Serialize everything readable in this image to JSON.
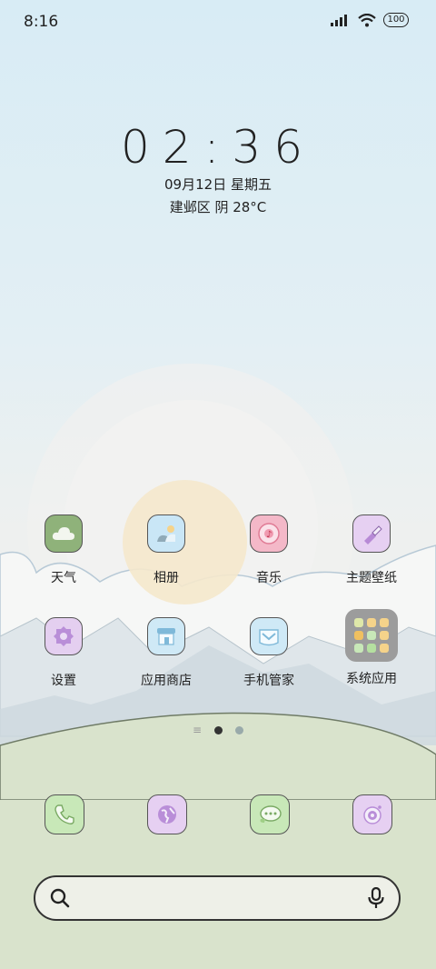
{
  "status_bar": {
    "time": "8:16",
    "battery": "100"
  },
  "clock": {
    "time": "02:36",
    "date": "09月12日 星期五",
    "weather": "建邺区 阴 28°C"
  },
  "apps_row1": [
    {
      "label": "天气",
      "icon": "weather-icon",
      "color": "#8fb27a"
    },
    {
      "label": "相册",
      "icon": "gallery-icon",
      "color": "#c9e6f6"
    },
    {
      "label": "音乐",
      "icon": "music-icon",
      "color": "#f4b8c8"
    },
    {
      "label": "主题壁纸",
      "icon": "themes-icon",
      "color": "#e6d0f2"
    }
  ],
  "apps_row2": [
    {
      "label": "设置",
      "icon": "settings-icon",
      "color": "#e4cff0"
    },
    {
      "label": "应用商店",
      "icon": "app-store-icon",
      "color": "#cfe9f6"
    },
    {
      "label": "手机管家",
      "icon": "security-icon",
      "color": "#cfe9f6"
    },
    {
      "label": "系统应用",
      "icon": "folder-icon",
      "color": "#9c9c9c"
    }
  ],
  "page_indicator": {
    "current_page": 1,
    "total_pages": 2
  },
  "dock": [
    {
      "name": "phone",
      "icon": "phone-icon",
      "color": "#c8e8b8"
    },
    {
      "name": "browser",
      "icon": "globe-icon",
      "color": "#e6d0f2"
    },
    {
      "name": "messages",
      "icon": "message-icon",
      "color": "#c8e8b8"
    },
    {
      "name": "camera",
      "icon": "camera-icon",
      "color": "#e6d0f2"
    }
  ],
  "search": {
    "placeholder": ""
  }
}
